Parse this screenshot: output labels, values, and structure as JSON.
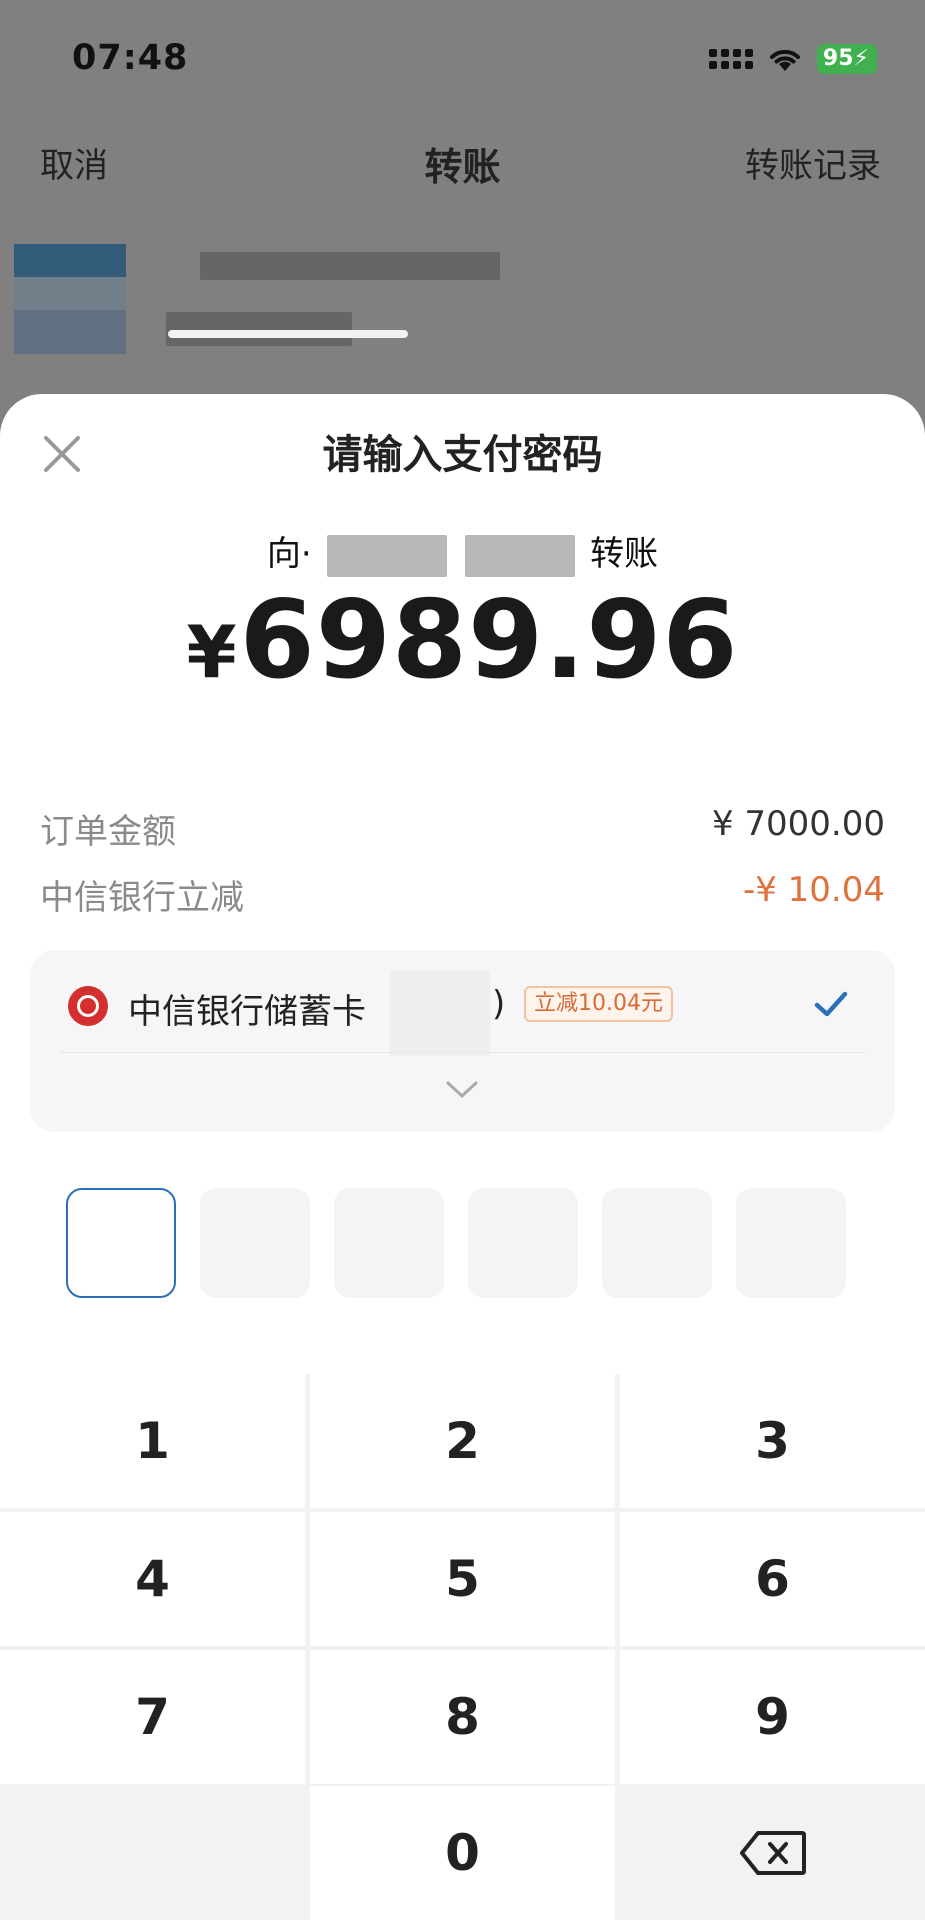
{
  "status_bar": {
    "time": "07:48",
    "battery": "95",
    "battery_color": "#3fb14e"
  },
  "nav": {
    "cancel": "取消",
    "title": "转账",
    "history": "转账记录"
  },
  "sheet": {
    "title": "请输入支付密码",
    "payee_prefix": "向·",
    "payee_suffix": "转账",
    "currency": "¥",
    "amount": "6989.96"
  },
  "details": {
    "order_label": "订单金额",
    "order_value": "¥ 7000.00",
    "discount_label": "中信银行立减",
    "discount_value": "-¥ 10.04",
    "discount_color": "#e0703c"
  },
  "payment_method": {
    "bank_name": "中信银行储蓄卡",
    "close_paren": ")",
    "badge": "立减10.04元",
    "logo_color": "#d32f2f",
    "check_color": "#2a6fb8",
    "icons": [
      "bank-logo-icon",
      "checkmark-icon",
      "chevron-down-icon"
    ]
  },
  "pin": {
    "length": 6,
    "filled": 0
  },
  "keypad": {
    "keys": [
      "1",
      "2",
      "3",
      "4",
      "5",
      "6",
      "7",
      "8",
      "9",
      "",
      "0",
      "backspace-icon"
    ]
  }
}
